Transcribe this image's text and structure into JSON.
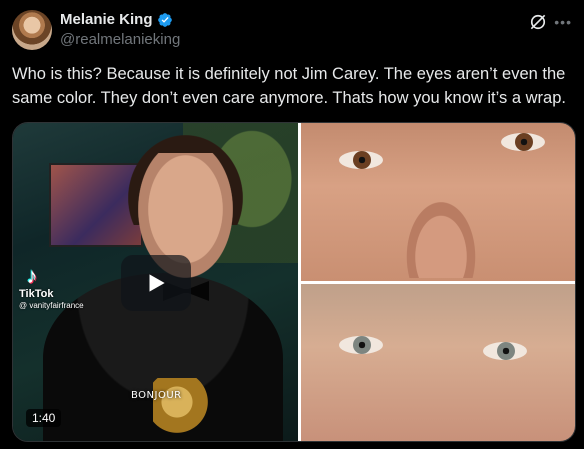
{
  "author": {
    "display_name": "Melanie King",
    "handle": "@realmelanieking",
    "verified": true
  },
  "icons": {
    "verified": "verified-badge-icon",
    "grok": "grok-icon",
    "more": "more-icon",
    "play": "play-icon"
  },
  "post": {
    "text": "Who is this? Because it is definitely not Jim Carey. The eyes aren’t even the same color. They don’t even care anymore. Thats how you know it’s a wrap."
  },
  "media": {
    "video": {
      "duration": "1:40",
      "watermark_brand": "TikTok",
      "watermark_handle": "@ vanityfairfrance",
      "caption_overlay": "BONJOUR"
    }
  },
  "colors": {
    "background": "#000000",
    "text": "#e7e9ea",
    "secondary_text": "#71767b",
    "verified_blue": "#1d9bf0"
  }
}
